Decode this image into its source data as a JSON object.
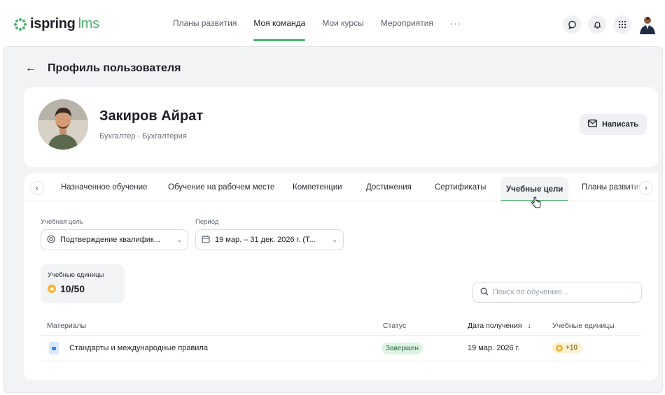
{
  "logo": {
    "brand": "ispring",
    "product": "lms"
  },
  "nav": {
    "items": [
      {
        "label": "Планы развития",
        "active": false
      },
      {
        "label": "Моя команда",
        "active": true
      },
      {
        "label": "Мои курсы",
        "active": false
      },
      {
        "label": "Мероприятия",
        "active": false
      }
    ],
    "more_label": "···"
  },
  "top_icons": [
    "chat-icon",
    "bell-icon",
    "apps-grid-icon",
    "user-avatar"
  ],
  "page": {
    "back_icon": "arrow-left-icon",
    "title": "Профиль пользователя"
  },
  "profile": {
    "name": "Закиров Айрат",
    "subtitle": "Бухгалтер · Бухгалтерия",
    "write_button": "Написать"
  },
  "tabs": [
    {
      "label": "Назначенное обучение",
      "active": false
    },
    {
      "label": "Обучение на рабочем месте",
      "active": false
    },
    {
      "label": "Компетенции",
      "active": false
    },
    {
      "label": "Достижения",
      "active": false
    },
    {
      "label": "Сертификаты",
      "active": false
    },
    {
      "label": "Учебные цели",
      "active": true
    },
    {
      "label": "Планы развития",
      "active": false
    }
  ],
  "filters": {
    "goal_label": "Учебная цель",
    "goal_value": "Подтверждение квалифик...",
    "period_label": "Период",
    "period_value": "19 мар. – 31 дек. 2026 г. (Т..."
  },
  "units": {
    "label": "Учебные единицы",
    "value": "10/50"
  },
  "search": {
    "placeholder": "Поиск по обучению..."
  },
  "table": {
    "columns": [
      "Материалы",
      "Статус",
      "Дата получения",
      "Учебные единицы"
    ],
    "sort_indicator": "↓",
    "rows": [
      {
        "material": "Стандарты и международные правила",
        "status": "Завершен",
        "date": "19 мар. 2026 г.",
        "units": "+10"
      }
    ]
  },
  "colors": {
    "accent": "#49b36b",
    "page_bg": "#f2f3f5",
    "status_done_bg": "#dff3e4",
    "coin": "#f5b43c"
  }
}
